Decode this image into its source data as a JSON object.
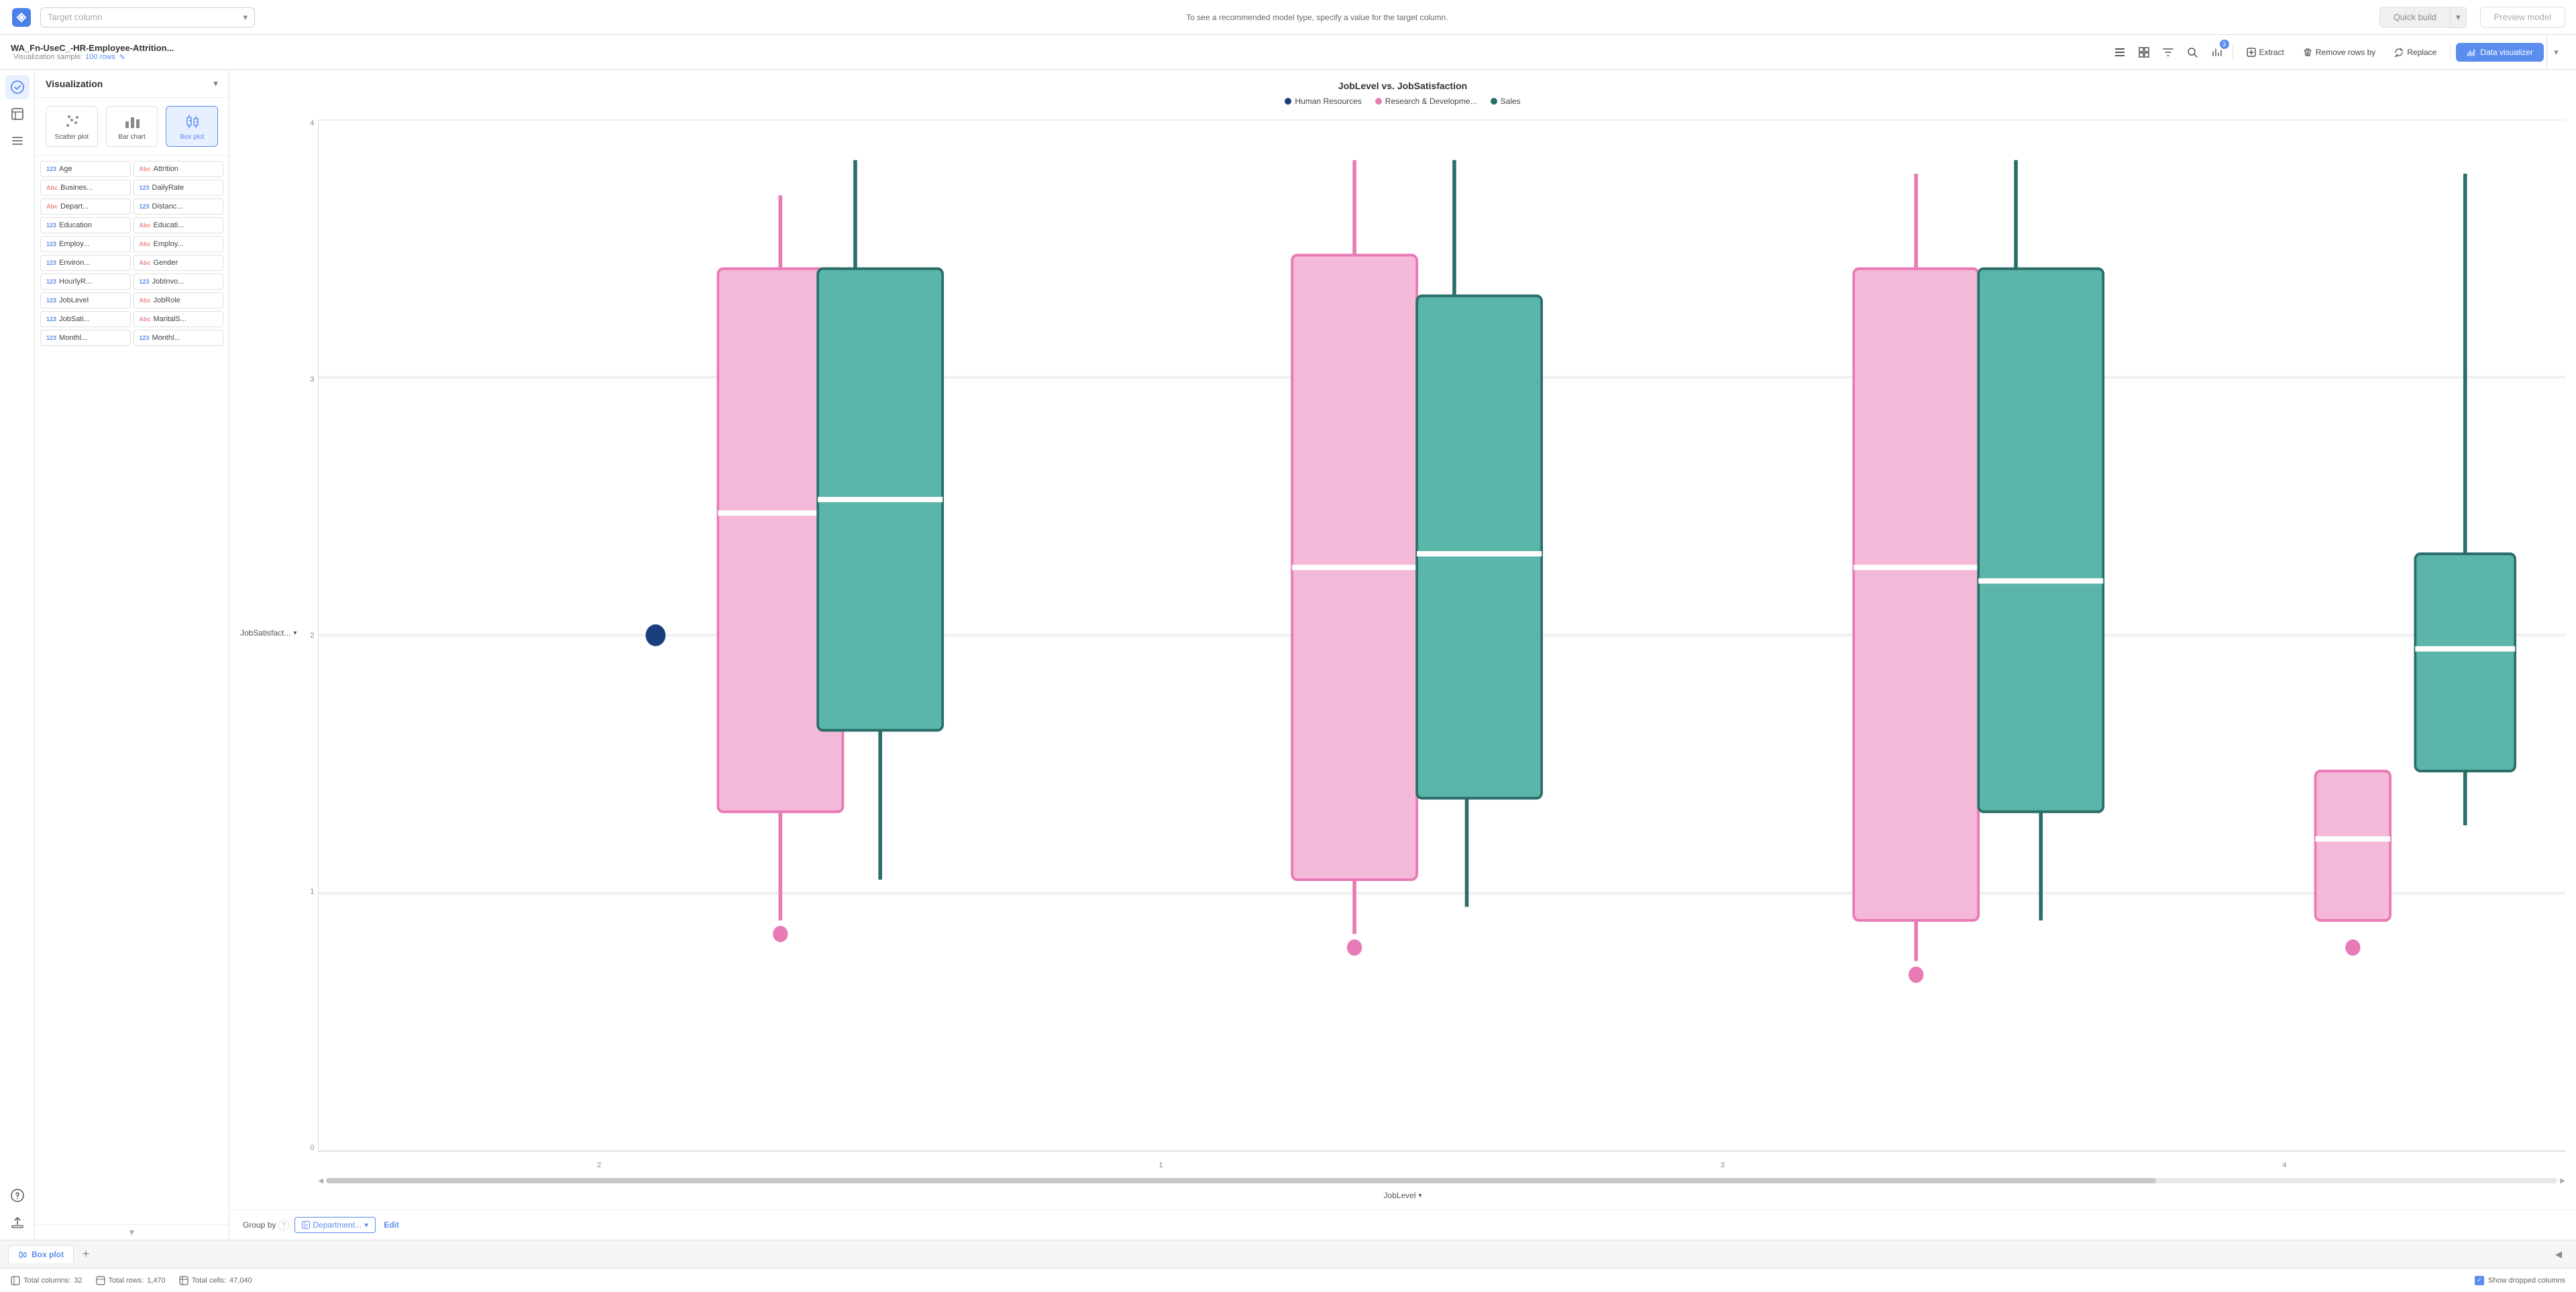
{
  "topbar": {
    "target_column_placeholder": "Target column",
    "hint_text": "To see a recommended model type, specify a value for the target column.",
    "quick_build_label": "Quick build",
    "preview_model_label": "Preview model"
  },
  "toolbar2": {
    "file_name": "WA_Fn-UseC_-HR-Employee-Attrition...",
    "sample_label": "Visualization sample:",
    "sample_value": "100 rows",
    "extract_label": "Extract",
    "remove_rows_label": "Remove rows by",
    "replace_label": "Replace",
    "data_visualizer_label": "Data visualizer",
    "filter_badge": "3"
  },
  "viz_panel": {
    "title": "Visualization",
    "chart_types": [
      {
        "id": "scatter",
        "label": "Scatter plot",
        "active": false
      },
      {
        "id": "bar",
        "label": "Bar chart",
        "active": false
      },
      {
        "id": "box",
        "label": "Box plot",
        "active": true
      }
    ],
    "columns": [
      {
        "type": "123",
        "label": "Age"
      },
      {
        "type": "Abc",
        "label": "Attrition"
      },
      {
        "type": "Abc",
        "label": "Busines..."
      },
      {
        "type": "123",
        "label": "DailyRate"
      },
      {
        "type": "Abc",
        "label": "Depart..."
      },
      {
        "type": "123",
        "label": "Distanc..."
      },
      {
        "type": "123",
        "label": "Education"
      },
      {
        "type": "Abc",
        "label": "Educati..."
      },
      {
        "type": "123",
        "label": "Employ..."
      },
      {
        "type": "Abc",
        "label": "Employ..."
      },
      {
        "type": "123",
        "label": "Environ..."
      },
      {
        "type": "Abc",
        "label": "Gender"
      },
      {
        "type": "123",
        "label": "HourlyR..."
      },
      {
        "type": "123",
        "label": "JobInvo..."
      },
      {
        "type": "123",
        "label": "JobLevel"
      },
      {
        "type": "Abc",
        "label": "JobRole"
      },
      {
        "type": "123",
        "label": "JobSati..."
      },
      {
        "type": "Abc",
        "label": "MaritalS..."
      },
      {
        "type": "123",
        "label": "Monthl..."
      },
      {
        "type": "123",
        "label": "Monthl..."
      }
    ]
  },
  "chart": {
    "title": "JobLevel vs. JobSatisfaction",
    "legend": [
      {
        "label": "Human Resources",
        "color": "#1a3d7c"
      },
      {
        "label": "Research & Developme...",
        "color": "#e87ab5"
      },
      {
        "label": "Sales",
        "color": "#2a6e6a"
      }
    ],
    "y_axis_label": "JobSatisfact...",
    "x_axis_label": "JobLevel",
    "y_ticks": [
      "4",
      "3",
      "2",
      "1",
      "0"
    ],
    "x_ticks": [
      "2",
      "1",
      "3",
      "4"
    ]
  },
  "group_by": {
    "label": "Group by",
    "value": "Department...",
    "edit_label": "Edit"
  },
  "tabs": [
    {
      "label": "Box plot",
      "icon": "box-icon",
      "active": true
    }
  ],
  "status_bar": {
    "columns_label": "Total columns:",
    "columns_val": "32",
    "rows_label": "Total rows:",
    "rows_val": "1,470",
    "cells_label": "Total cells:",
    "cells_val": "47,040",
    "show_dropped": "Show dropped columns"
  },
  "education_label": "123 Education",
  "left_nav": {
    "icons": [
      "🤖",
      "📊",
      "≡",
      "?",
      "⬆"
    ]
  }
}
